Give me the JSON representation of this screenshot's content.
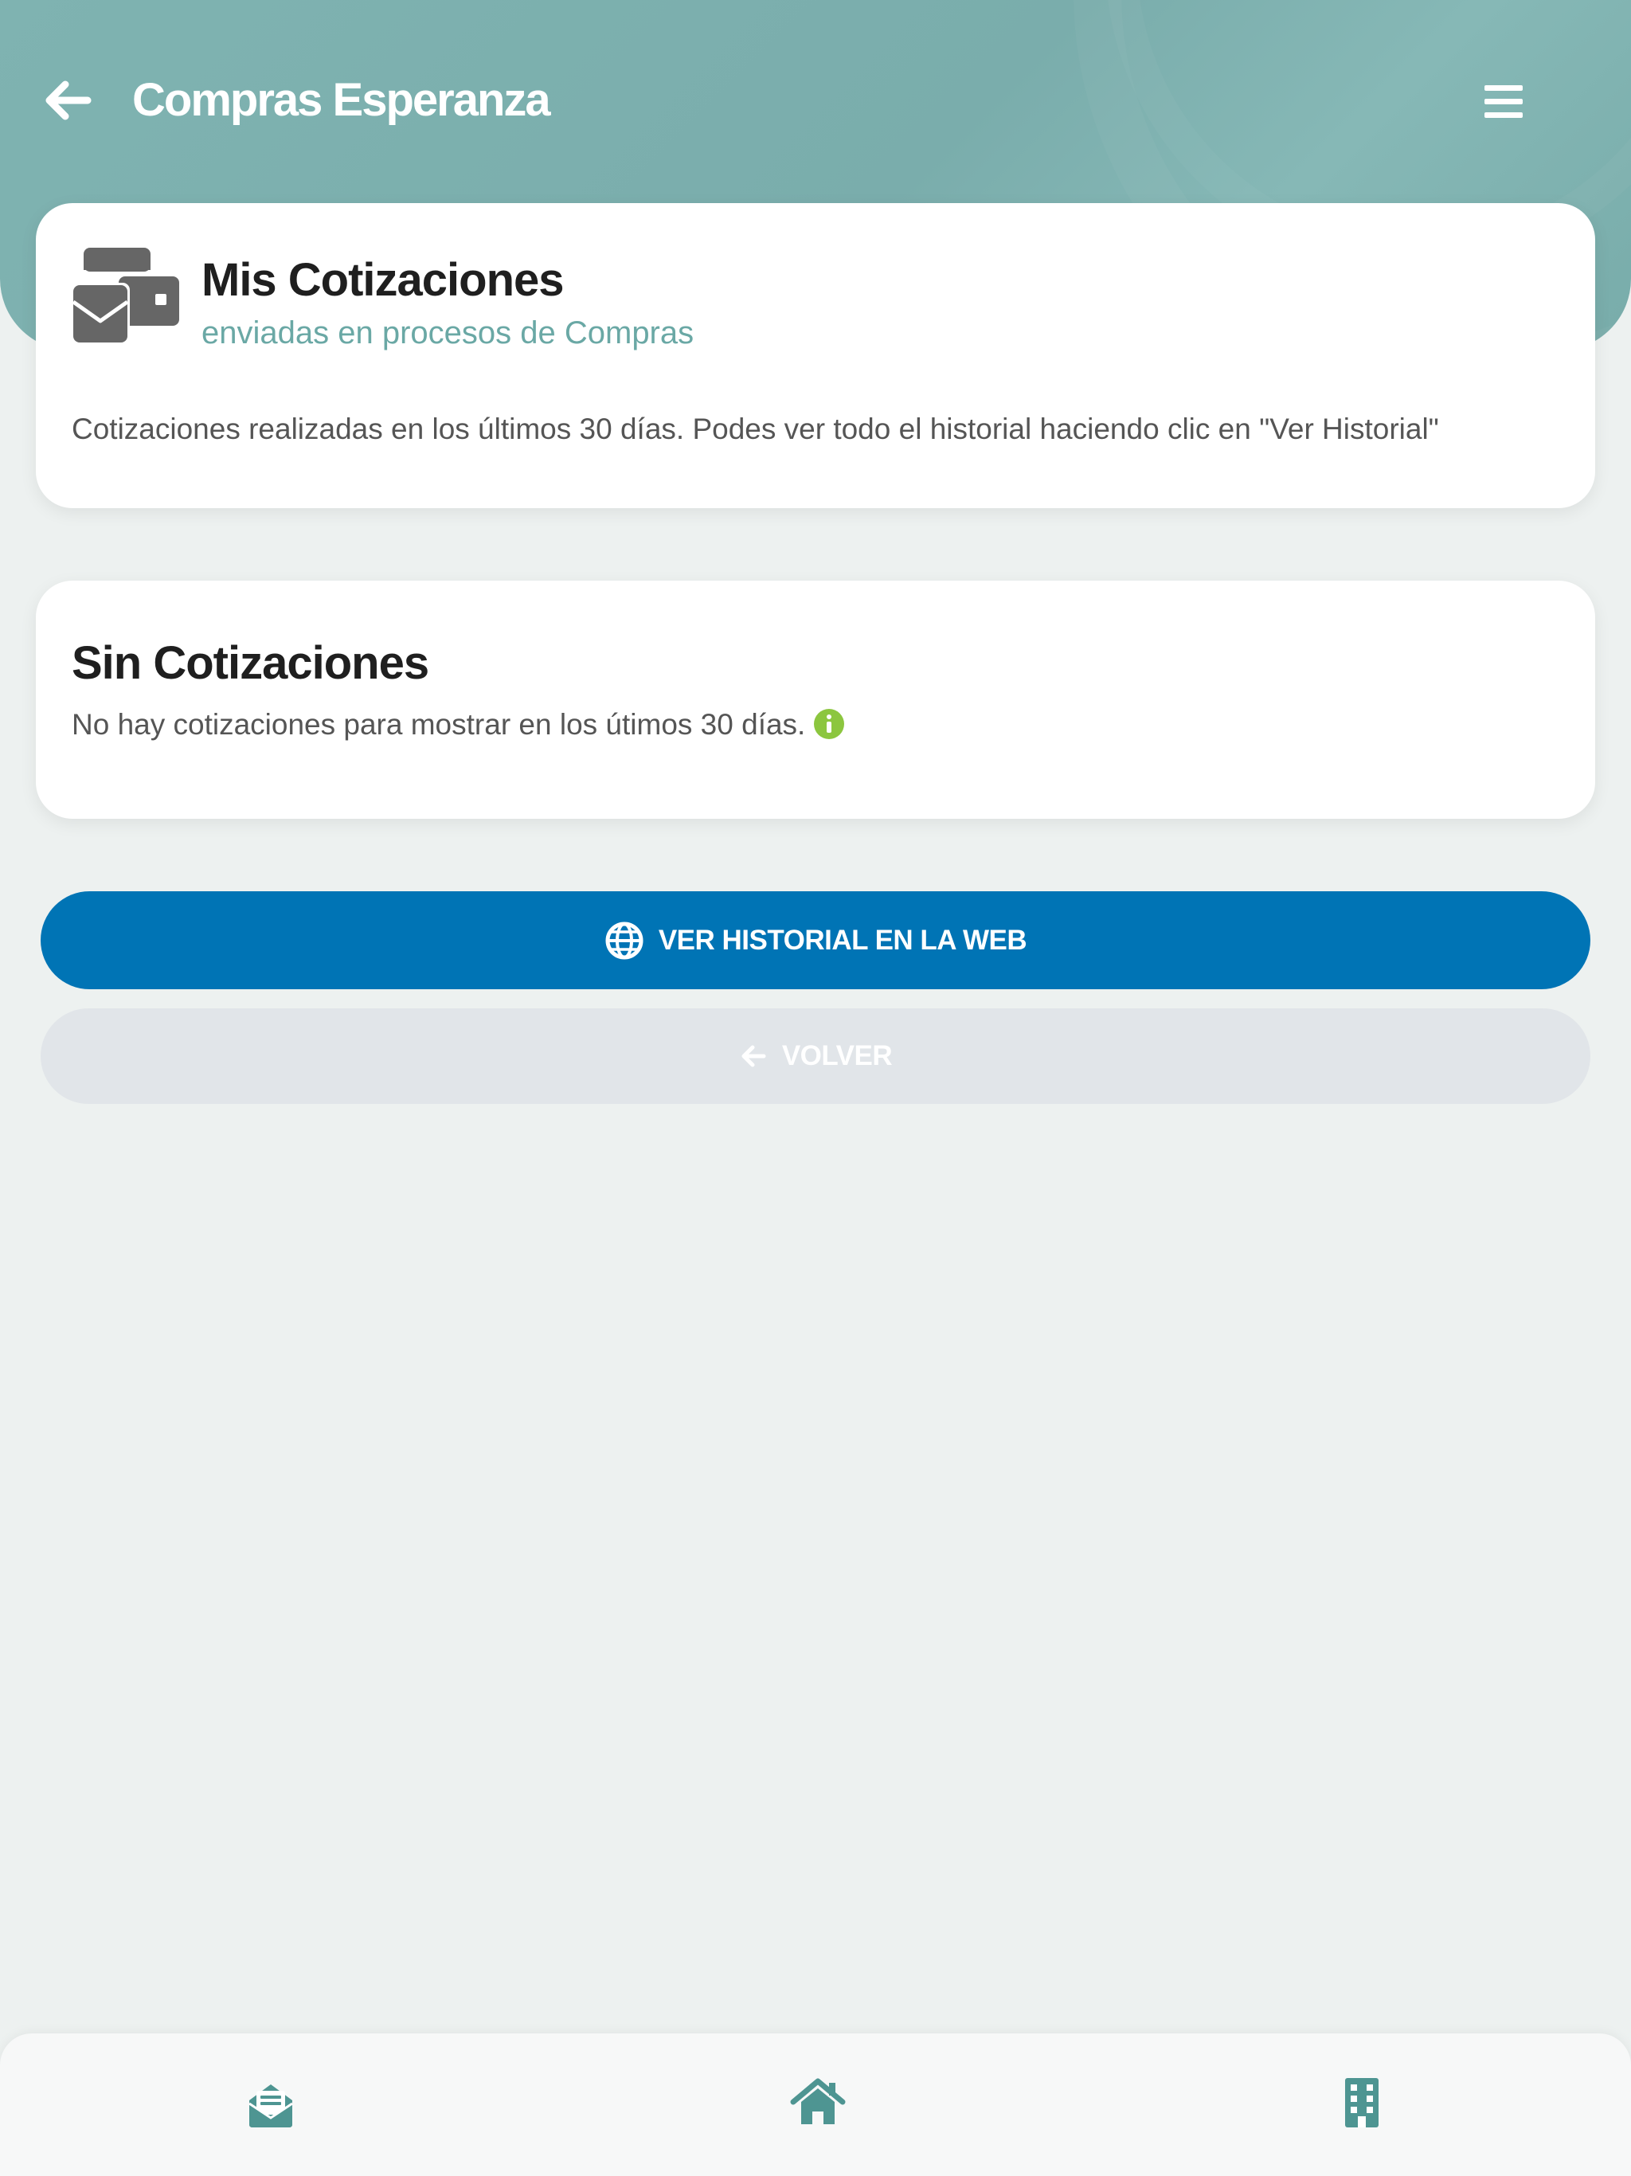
{
  "header": {
    "title": "Compras Esperanza",
    "back_icon": "arrow-left-icon",
    "menu_icon": "hamburger-menu-icon",
    "background_color": "#7fb3b1"
  },
  "summary_card": {
    "icon": "envelopes-icon",
    "title": "Mis Cotizaciones",
    "subtitle": "enviadas en procesos de Compras",
    "description": "Cotizaciones realizadas en los últimos 30 días. Podes ver todo el historial haciendo clic en \"Ver Historial\""
  },
  "empty_card": {
    "title": "Sin Cotizaciones",
    "message": "No hay cotizaciones para mostrar en los útimos 30 días.",
    "info_icon": "info-circle-icon",
    "info_color": "#8cc63f"
  },
  "actions": {
    "history_label": "VER HISTORIAL EN LA WEB",
    "history_icon": "globe-icon",
    "history_color": "#0074b5",
    "back_label": "VOLVER",
    "back_icon": "arrow-left-icon",
    "back_color": "#e1e5e9"
  },
  "bottom_nav": {
    "items": [
      {
        "name": "cotizaciones",
        "icon": "envelope-open-text-icon"
      },
      {
        "name": "home",
        "icon": "home-icon"
      },
      {
        "name": "empresa",
        "icon": "building-icon"
      }
    ],
    "icon_color": "#4e9592"
  }
}
